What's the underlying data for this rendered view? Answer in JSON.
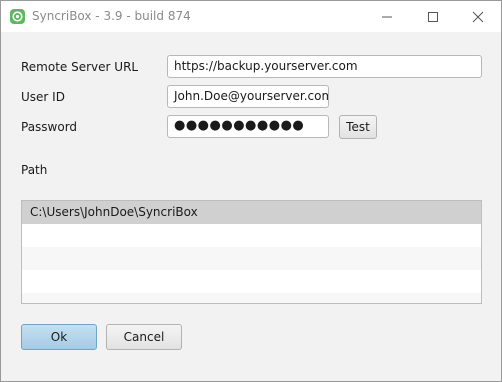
{
  "window": {
    "title": "SyncriBox - 3.9 - build 874",
    "icon": "syncribox-app-icon",
    "controls": {
      "minimize": "minimize-icon",
      "maximize": "maximize-icon",
      "close": "close-icon"
    }
  },
  "form": {
    "server_url": {
      "label": "Remote Server URL",
      "value": "https://backup.yourserver.com"
    },
    "user_id": {
      "label": "User ID",
      "value": "John.Doe@yourserver.com"
    },
    "password": {
      "label": "Password",
      "value": "●●●●●●●●●●●"
    },
    "test_button": "Test",
    "path": {
      "label": "Path",
      "items": [
        "C:\\Users\\JohnDoe\\SyncriBox"
      ]
    }
  },
  "actions": {
    "ok": "Ok",
    "cancel": "Cancel"
  },
  "colors": {
    "accent_button": "#a4cbe5",
    "selected_row": "#d0d0d0",
    "app_icon": "#5cb85c"
  }
}
